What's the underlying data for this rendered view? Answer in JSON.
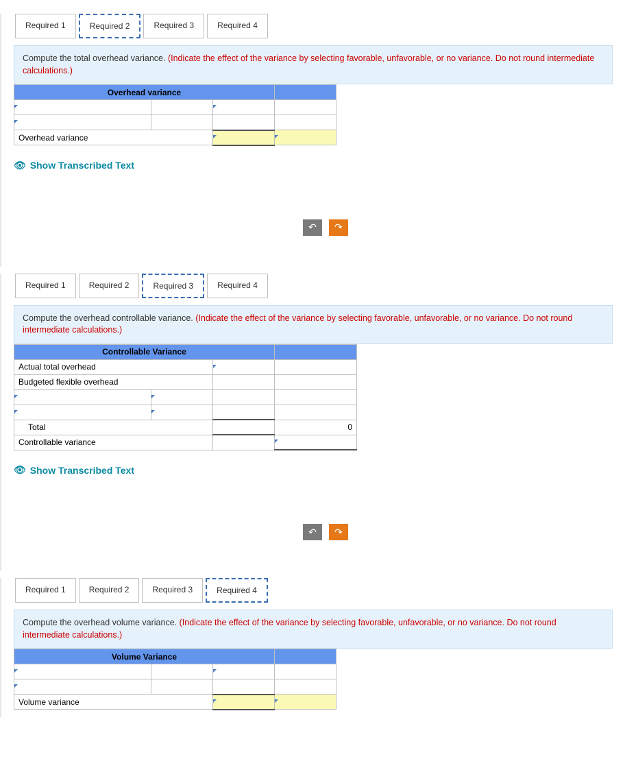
{
  "sections": [
    {
      "tabs": [
        "Required 1",
        "Required 2",
        "Required 3",
        "Required 4"
      ],
      "activeTab": 1,
      "instruction_black": "Compute the total overhead variance. ",
      "instruction_red": "(Indicate the effect of the variance by selecting favorable, unfavorable, or no variance. Do not round intermediate calculations.)",
      "header": "Overhead variance",
      "rows": [
        {
          "label": "",
          "v1": "",
          "v2": ""
        },
        {
          "label": "",
          "v1": "",
          "v2": ""
        },
        {
          "label": "Overhead variance",
          "v1": "",
          "v2": ""
        }
      ]
    },
    {
      "tabs": [
        "Required 1",
        "Required 2",
        "Required 3",
        "Required 4"
      ],
      "activeTab": 2,
      "instruction_black": "Compute the overhead controllable variance. ",
      "instruction_red": "(Indicate the effect of the variance by selecting favorable, unfavorable, or no variance. Do not round intermediate calculations.)",
      "header": "Controllable Variance",
      "rows": [
        {
          "label": "Actual total overhead",
          "v1": "",
          "v2": ""
        },
        {
          "label": "Budgeted flexible overhead",
          "v1": "",
          "v2": ""
        },
        {
          "label": "",
          "v1": "",
          "v2": ""
        },
        {
          "label": "",
          "v1": "",
          "v2": ""
        },
        {
          "label": "Total",
          "v1": "",
          "v2": "0"
        },
        {
          "label": "Controllable variance",
          "v1": "",
          "v2": ""
        }
      ]
    },
    {
      "tabs": [
        "Required 1",
        "Required 2",
        "Required 3",
        "Required 4"
      ],
      "activeTab": 3,
      "instruction_black": "Compute the overhead volume variance. ",
      "instruction_red": "(Indicate the effect of the variance by selecting favorable, unfavorable, or no variance. Do not round intermediate calculations.)",
      "header": "Volume Variance",
      "rows": [
        {
          "label": "",
          "v1": "",
          "v2": ""
        },
        {
          "label": "",
          "v1": "",
          "v2": ""
        },
        {
          "label": "Volume variance",
          "v1": "",
          "v2": ""
        }
      ]
    }
  ],
  "show_text": "Show Transcribed Text",
  "nav": {
    "back": "↶",
    "forward": "↷"
  }
}
